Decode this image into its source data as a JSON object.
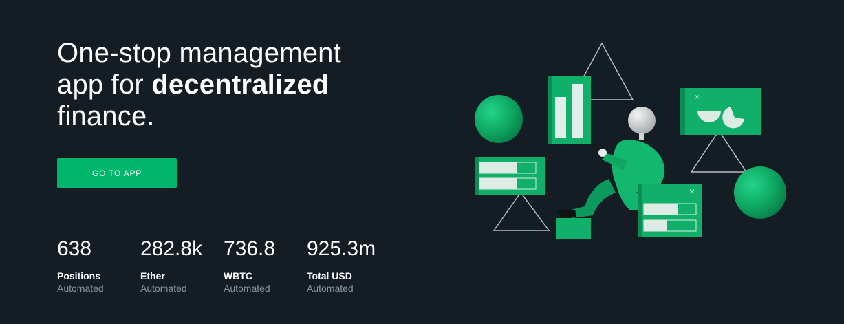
{
  "hero": {
    "title_line1": "One-stop management",
    "title_line2_prefix": "app for ",
    "title_line2_bold": "decentralized",
    "title_line3": "finance."
  },
  "cta": {
    "label": "GO TO APP"
  },
  "stats": [
    {
      "value": "638",
      "label": "Positions",
      "sub": "Automated"
    },
    {
      "value": "282.8k",
      "label": "Ether",
      "sub": "Automated"
    },
    {
      "value": "736.8",
      "label": "WBTC",
      "sub": "Automated"
    },
    {
      "value": "925.3m",
      "label": "Total USD",
      "sub": "Automated"
    }
  ],
  "colors": {
    "background": "#141c24",
    "accent": "#00b66d",
    "muted_text": "#8b929a"
  }
}
